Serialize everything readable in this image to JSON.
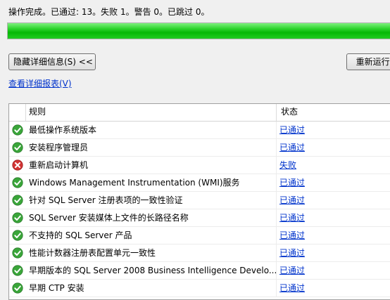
{
  "summary": "操作完成。已通过: 13。失败 1。警告 0。已跳过 0。",
  "progress": {
    "percent": 100,
    "color": "#19c419"
  },
  "buttons": {
    "hide_details": "隐藏详细信息(S) <<",
    "rerun": "重新运行("
  },
  "report_link": "查看详细报表(V)",
  "table": {
    "headers": {
      "rule": "规则",
      "status": "状态"
    },
    "rows": [
      {
        "rule": "最低操作系统版本",
        "status": "已通过",
        "result": "pass"
      },
      {
        "rule": "安装程序管理员",
        "status": "已通过",
        "result": "pass"
      },
      {
        "rule": "重新启动计算机",
        "status": "失败",
        "result": "fail"
      },
      {
        "rule": "Windows Management Instrumentation (WMI)服务",
        "status": "已通过",
        "result": "pass"
      },
      {
        "rule": "针对 SQL Server 注册表项的一致性验证",
        "status": "已通过",
        "result": "pass"
      },
      {
        "rule": "SQL Server 安装媒体上文件的长路径名称",
        "status": "已通过",
        "result": "pass"
      },
      {
        "rule": "不支持的 SQL Server 产品",
        "status": "已通过",
        "result": "pass"
      },
      {
        "rule": "性能计数器注册表配置单元一致性",
        "status": "已通过",
        "result": "pass"
      },
      {
        "rule": "早期版本的 SQL Server 2008 Business Intelligence Develo...",
        "status": "已通过",
        "result": "pass"
      },
      {
        "rule": "早期 CTP 安装",
        "status": "已通过",
        "result": "pass"
      }
    ]
  },
  "colors": {
    "pass": "#3aa63a",
    "fail": "#d23434",
    "link": "#0033cc"
  },
  "icons": {
    "pass": "check-circle-icon",
    "fail": "x-circle-icon"
  }
}
